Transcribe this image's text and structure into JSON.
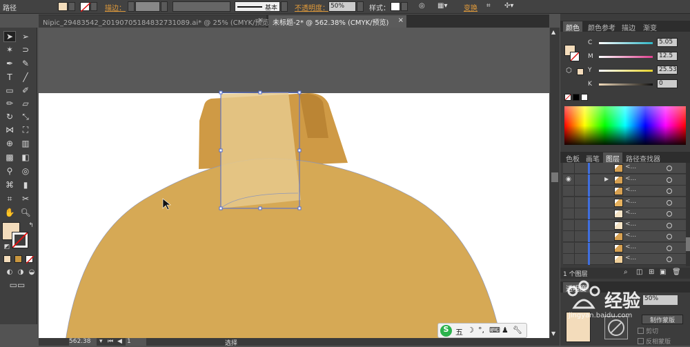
{
  "control_bar": {
    "path_label": "路径",
    "stroke_label": "描边：",
    "stroke_style": "基本",
    "opacity_label": "不透明度：",
    "opacity_value": "50%",
    "style_label": "样式：",
    "transform_label": "变换"
  },
  "tabs": [
    {
      "label": "Nipic_29483542_20190705184832731089.ai* @ 25% (CMYK/预览)",
      "close": "×"
    },
    {
      "label": "未标题-2* @ 562.38% (CMYK/预览)",
      "close": "×"
    }
  ],
  "color_panel": {
    "tabs": [
      "颜色",
      "颜色参考",
      "描边",
      "渐变"
    ],
    "channels": [
      {
        "name": "C",
        "value": "5.05",
        "color": "#2fb6c6"
      },
      {
        "name": "M",
        "value": "12.5",
        "color": "#e0408f"
      },
      {
        "name": "Y",
        "value": "25.53",
        "color": "#e7d42c"
      },
      {
        "name": "K",
        "value": "0",
        "color": "#444444"
      }
    ],
    "fill_color": "#f3dcbb"
  },
  "layers_panel": {
    "tabs": [
      "色板",
      "画笔",
      "图层",
      "路径查找器"
    ],
    "rows": [
      {
        "label": "<...",
        "color": "#d7a152",
        "visible": false,
        "expand": false
      },
      {
        "label": "<...",
        "color": "#d7a152",
        "visible": true,
        "expand": true
      },
      {
        "label": "<...",
        "color": "#d7a152",
        "visible": false,
        "expand": false
      },
      {
        "label": "<...",
        "color": "#e7b25e",
        "visible": false,
        "expand": false
      },
      {
        "label": "<...",
        "color": "#f5e4c6",
        "visible": false,
        "expand": false
      },
      {
        "label": "<...",
        "color": "#f5e4c6",
        "visible": false,
        "expand": false
      },
      {
        "label": "<...",
        "color": "#d7a152",
        "visible": false,
        "expand": false
      },
      {
        "label": "<...",
        "color": "#d7a152",
        "visible": false,
        "expand": false
      },
      {
        "label": "<...",
        "color": "#f0d09a",
        "visible": false,
        "expand": false
      }
    ],
    "footer_label": "1 个图层"
  },
  "transparency_panel": {
    "tab": "透明度",
    "opacity": "50%",
    "make_mask": "制作蒙版",
    "clip": "剪切",
    "invert": "反相蒙版"
  },
  "status_bar": {
    "zoom": "562.38",
    "artboard": "1",
    "mode": "选择"
  },
  "ime_bar": {
    "logo": "S",
    "mode": "五"
  },
  "watermark": {
    "text": "经验",
    "sub": "jingyan.baidu.com"
  },
  "colors": {
    "bell": "#d6a955",
    "neck_dark": "#c18a3a",
    "neck_light": "#e3be7b",
    "selection": "#4e6bd6",
    "fill_swatch": "#f3dcbb"
  }
}
